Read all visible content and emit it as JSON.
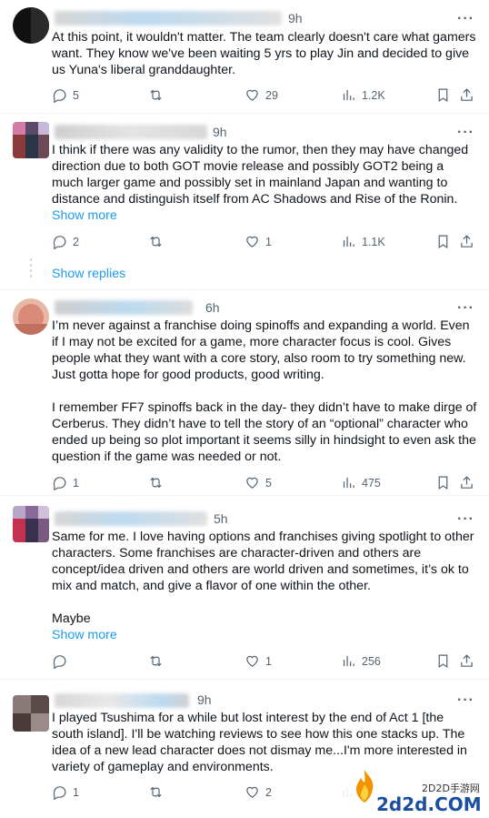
{
  "tweets": [
    {
      "time": "9h",
      "text": "At this point, it wouldn't matter. The team clearly doesn't care what gamers want. They know we've been waiting 5 yrs to play Jin and decided to give us Yuna's liberal granddaughter.",
      "replies": "5",
      "reposts": "",
      "likes": "29",
      "views": "1.2K"
    },
    {
      "time": "9h",
      "text": "I think if there was any validity to the rumor, then they may have changed direction due to both GOT movie release and possibly GOT2 being a much larger game and possibly set in mainland Japan and wanting to distance and distinguish itself from AC Shadows and Rise of the Ronin.",
      "show_more": "Show more",
      "replies": "2",
      "reposts": "",
      "likes": "1",
      "views": "1.1K"
    },
    {
      "time": "6h",
      "text": "I’m never against a franchise doing spinoffs and expanding a world. Even if I may not be excited for a game, more character focus is cool. Gives people what they want with a core story, also room to try something new. Just gotta hope for good products, good writing.\n\nI remember FF7 spinoffs back in the day- they didn’t have to make dirge of Cerberus. They didn’t have to tell the story of an “optional” character who ended up being so plot important it seems silly in hindsight to even ask the question if the game was needed or not.",
      "replies": "1",
      "reposts": "",
      "likes": "5",
      "views": "475"
    },
    {
      "time": "5h",
      "text": "Same for me. I love having options and franchises giving spotlight to other characters. Some franchises are character-driven and others are concept/idea driven and others are world driven and sometimes, it’s ok to mix and match, and give a flavor of one within the other.\n\nMaybe",
      "show_more": "Show more",
      "replies": "",
      "reposts": "",
      "likes": "1",
      "views": "256"
    },
    {
      "time": "9h",
      "text": "I played Tsushima for a while but lost interest by the end of Act 1 [the south island]. I'll be watching reviews to see how this one stacks up. The idea of a new lead character does not dismay me...I'm more interested in variety of gameplay and environments.",
      "replies": "1",
      "reposts": "",
      "likes": "2",
      "views": ""
    }
  ],
  "show_replies": "Show replies",
  "more_glyph": "···",
  "watermark": {
    "cn_text": "2D2D手游网",
    "domain": "2d2d.COM"
  },
  "colors": {
    "link": "#1d9bf0",
    "muted": "#536471",
    "text": "#0f1419"
  }
}
